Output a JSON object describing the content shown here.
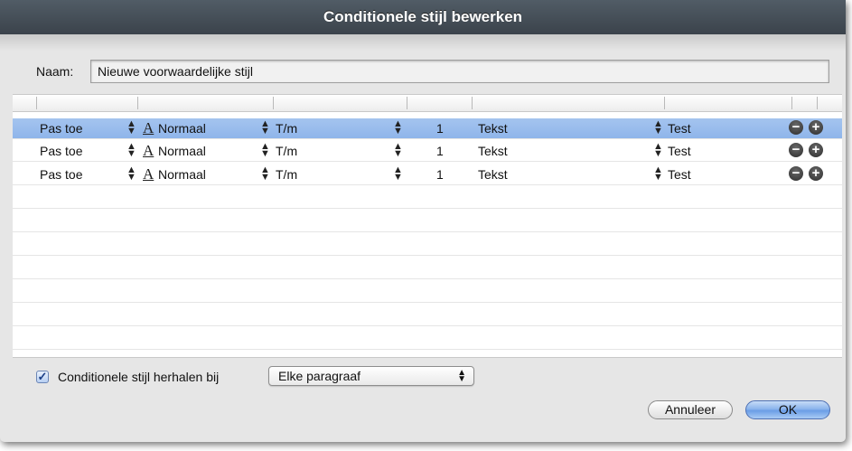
{
  "window": {
    "title": "Conditionele stijl bewerken"
  },
  "naam": {
    "label": "Naam:",
    "value": "Nieuwe voorwaardelijke stijl"
  },
  "rows": [
    {
      "action": "Pas toe",
      "style": "Normaal",
      "range": "T/m",
      "count": "1",
      "unit": "Tekst",
      "target": "Test",
      "selected": true
    },
    {
      "action": "Pas toe",
      "style": "Normaal",
      "range": "T/m",
      "count": "1",
      "unit": "Tekst",
      "target": "Test",
      "selected": false
    },
    {
      "action": "Pas toe",
      "style": "Normaal",
      "range": "T/m",
      "count": "1",
      "unit": "Tekst",
      "target": "Test",
      "selected": false
    }
  ],
  "icons": {
    "font": "A",
    "remove": "−",
    "add": "+"
  },
  "repeat": {
    "checked": true,
    "label": "Conditionele stijl herhalen bij",
    "option": "Elke paragraaf"
  },
  "buttons": {
    "cancel": "Annuleer",
    "ok": "OK"
  }
}
